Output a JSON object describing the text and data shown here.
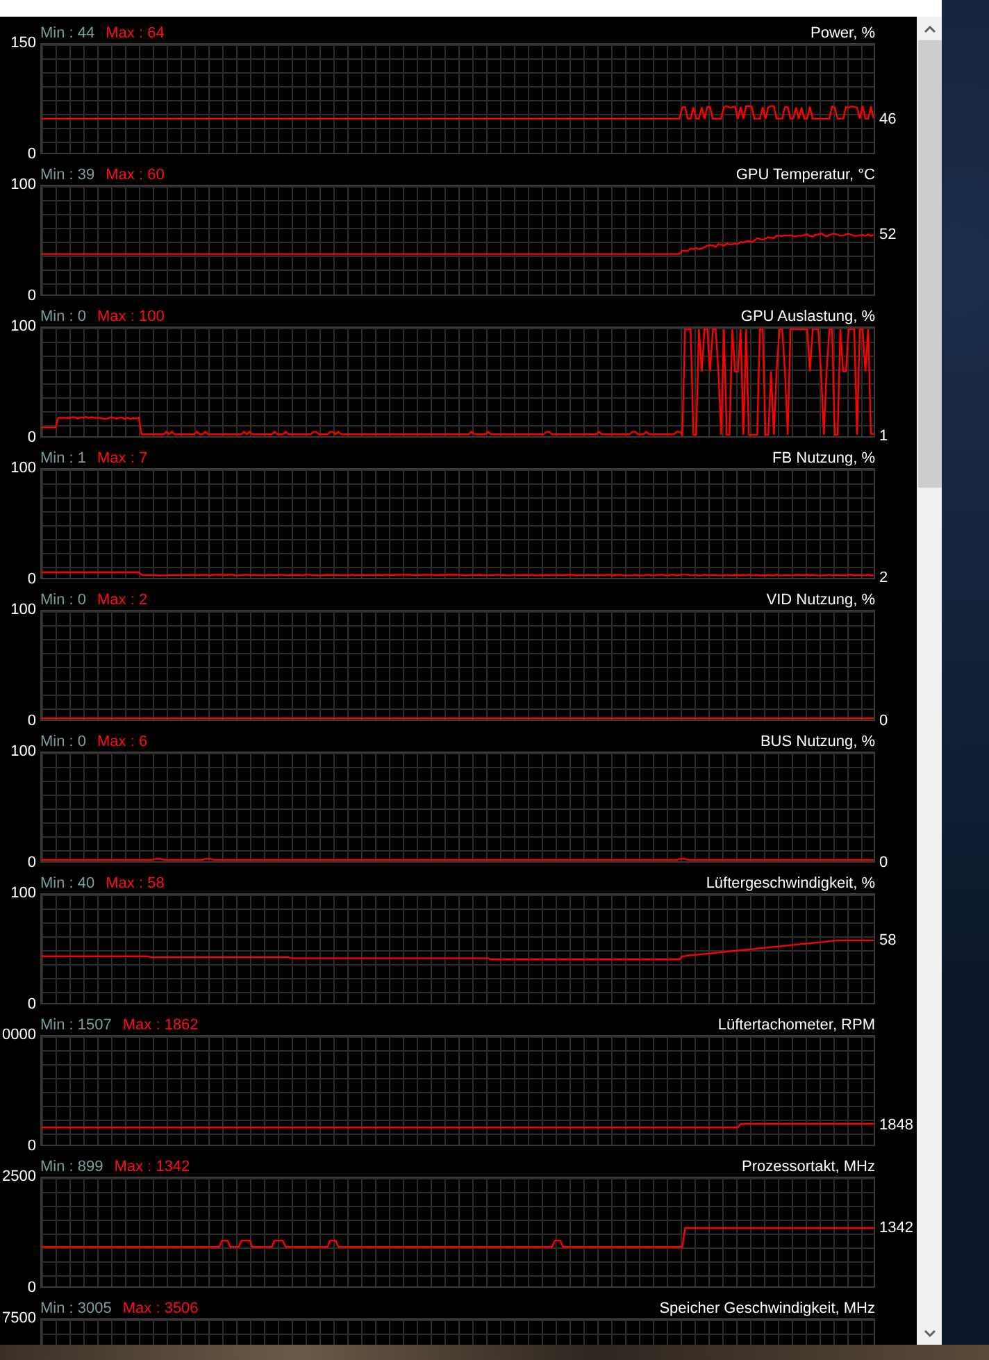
{
  "graphs": [
    {
      "min_label": "Min : 44",
      "max_label": "Max : 64",
      "title": "Power, %",
      "axis_max": "150",
      "axis_min": "0",
      "current": "46"
    },
    {
      "min_label": "Min : 39",
      "max_label": "Max : 60",
      "title": "GPU Temperatur, °C",
      "axis_max": "100",
      "axis_min": "0",
      "current": "52"
    },
    {
      "min_label": "Min : 0",
      "max_label": "Max : 100",
      "title": "GPU Auslastung, %",
      "axis_max": "100",
      "axis_min": "0",
      "current": "1"
    },
    {
      "min_label": "Min : 1",
      "max_label": "Max : 7",
      "title": "FB Nutzung, %",
      "axis_max": "100",
      "axis_min": "0",
      "current": "2"
    },
    {
      "min_label": "Min : 0",
      "max_label": "Max : 2",
      "title": "VID Nutzung, %",
      "axis_max": "100",
      "axis_min": "0",
      "current": "0"
    },
    {
      "min_label": "Min : 0",
      "max_label": "Max : 6",
      "title": "BUS Nutzung, %",
      "axis_max": "100",
      "axis_min": "0",
      "current": "0"
    },
    {
      "min_label": "Min : 40",
      "max_label": "Max : 58",
      "title": "Lüftergeschwindigkeit, %",
      "axis_max": "100",
      "axis_min": "0",
      "current": "58"
    },
    {
      "min_label": "Min : 1507",
      "max_label": "Max : 1862",
      "title": "Lüftertachometer, RPM",
      "axis_max": "0000",
      "axis_min": "0",
      "current": "1848"
    },
    {
      "min_label": "Min : 899",
      "max_label": "Max : 1342",
      "title": "Prozessortakt, MHz",
      "axis_max": "2500",
      "axis_min": "0",
      "current": "1342"
    },
    {
      "min_label": "Min : 3005",
      "max_label": "Max : 3506",
      "title": "Speicher Geschwindigkeit, MHz",
      "axis_max": "7500"
    }
  ]
}
